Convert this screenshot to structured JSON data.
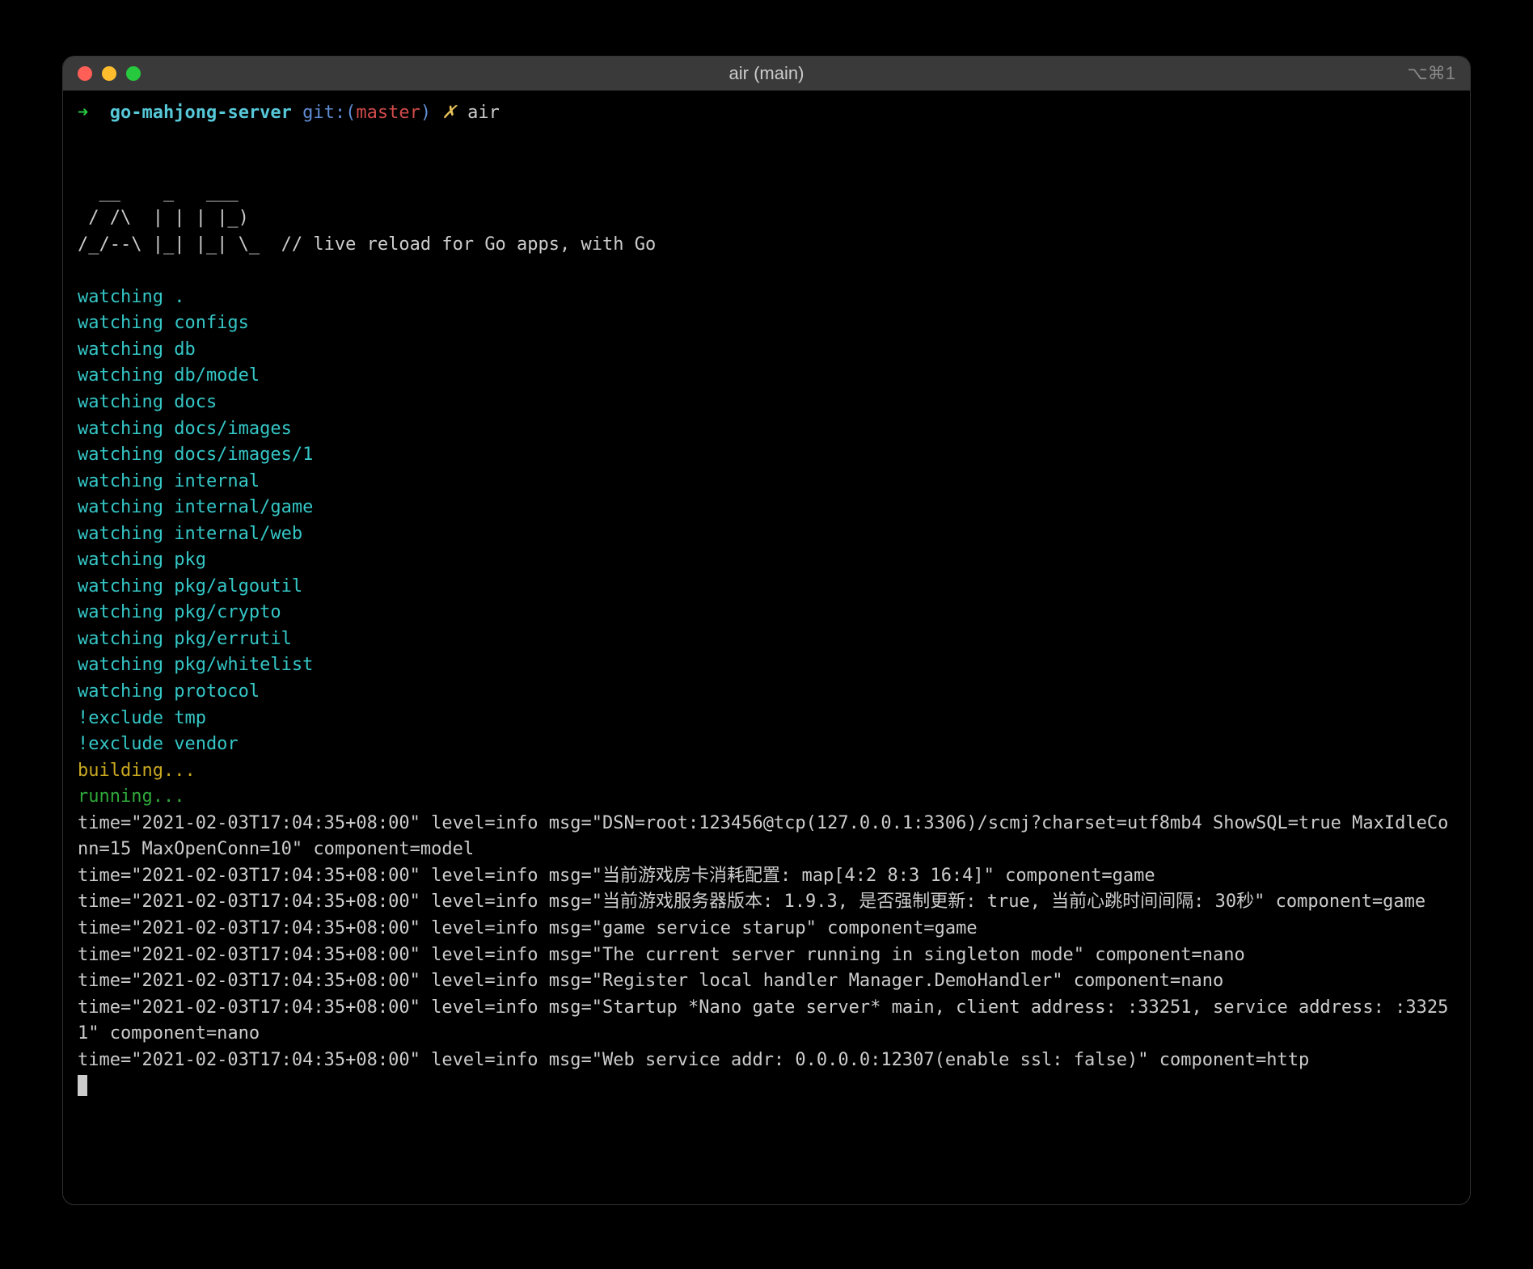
{
  "window": {
    "title": "air (main)",
    "shortcut": "⌥⌘1"
  },
  "prompt": {
    "arrow": "➜",
    "dir": "go-mahjong-server",
    "git_label": "git:(",
    "branch": "master",
    "git_close": ")",
    "marker": "✗",
    "cmd": "air"
  },
  "ascii": {
    "l1": "  __    _   ___  ",
    "l2": " / /\\  | | | |_) ",
    "l3": "/_/--\\ |_| |_| \\_  // live reload for Go apps, with Go "
  },
  "watching": [
    "watching .",
    "watching configs",
    "watching db",
    "watching db/model",
    "watching docs",
    "watching docs/images",
    "watching docs/images/1",
    "watching internal",
    "watching internal/game",
    "watching internal/web",
    "watching pkg",
    "watching pkg/algoutil",
    "watching pkg/crypto",
    "watching pkg/errutil",
    "watching pkg/whitelist",
    "watching protocol"
  ],
  "excludes": [
    "!exclude tmp",
    "!exclude vendor"
  ],
  "building": "building...",
  "running": "running...",
  "logs": [
    "time=\"2021-02-03T17:04:35+08:00\" level=info msg=\"DSN=root:123456@tcp(127.0.0.1:3306)/scmj?charset=utf8mb4 ShowSQL=true MaxIdleConn=15 MaxOpenConn=10\" component=model",
    "time=\"2021-02-03T17:04:35+08:00\" level=info msg=\"当前游戏房卡消耗配置: map[4:2 8:3 16:4]\" component=game",
    "time=\"2021-02-03T17:04:35+08:00\" level=info msg=\"当前游戏服务器版本: 1.9.3, 是否强制更新: true, 当前心跳时间间隔: 30秒\" component=game",
    "time=\"2021-02-03T17:04:35+08:00\" level=info msg=\"game service starup\" component=game",
    "time=\"2021-02-03T17:04:35+08:00\" level=info msg=\"The current server running in singleton mode\" component=nano",
    "time=\"2021-02-03T17:04:35+08:00\" level=info msg=\"Register local handler Manager.DemoHandler\" component=nano",
    "time=\"2021-02-03T17:04:35+08:00\" level=info msg=\"Startup *Nano gate server* main, client address: :33251, service address: :33251\" component=nano",
    "time=\"2021-02-03T17:04:35+08:00\" level=info msg=\"Web service addr: 0.0.0.0:12307(enable ssl: false)\" component=http"
  ]
}
